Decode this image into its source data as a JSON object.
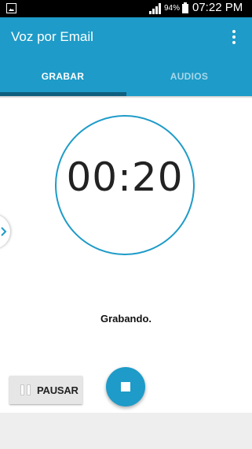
{
  "status_bar": {
    "battery_percent": "94%",
    "time": "07:22 PM",
    "icons": [
      "image-notification-icon",
      "signal-icon",
      "battery-icon"
    ]
  },
  "app_bar": {
    "title": "Voz por Email",
    "overflow_icon": "more-vert-icon"
  },
  "tabs": [
    {
      "label": "GRABAR",
      "selected": true
    },
    {
      "label": "AUDIOS",
      "selected": false
    }
  ],
  "timer": {
    "value": "00:20"
  },
  "recording": {
    "status": "Grabando."
  },
  "controls": {
    "pause_label": "PAUSAR",
    "pause_icon": "pause-icon",
    "stop_icon": "stop-icon"
  },
  "side_drawer": {
    "icon": "chevron-right-icon"
  },
  "colors": {
    "primary": "#1e9bc8",
    "tab_indicator": "#0f5f7f",
    "background": "#ffffff"
  }
}
